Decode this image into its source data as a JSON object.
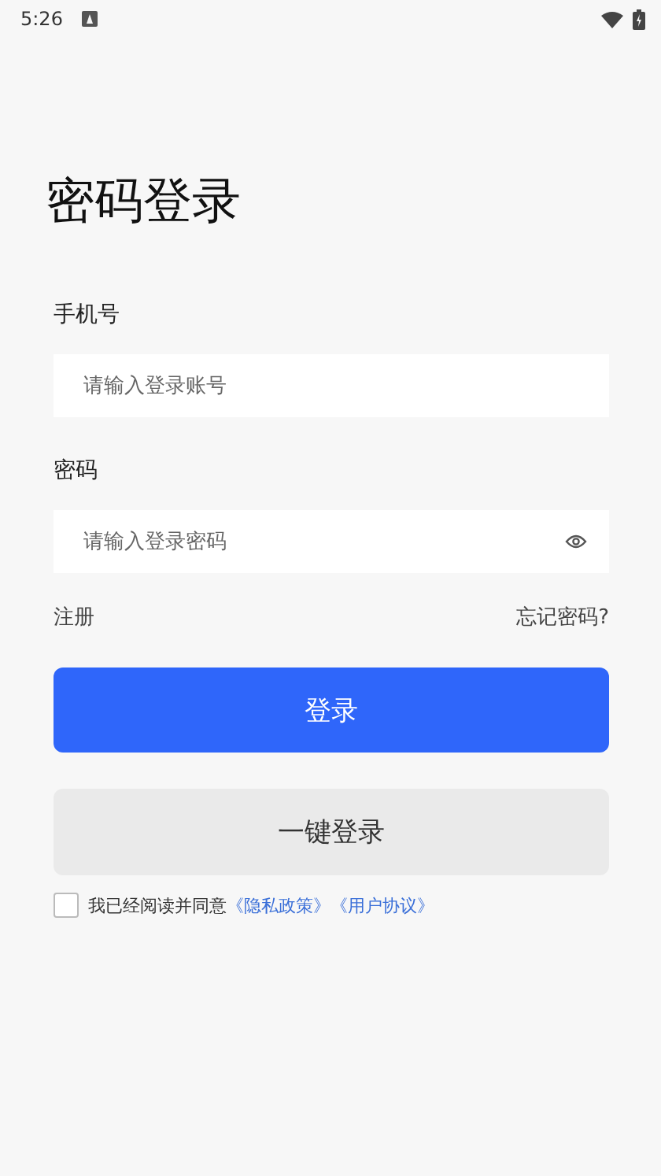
{
  "status_bar": {
    "time": "5:26"
  },
  "title": "密码登录",
  "fields": [
    {
      "label": "手机号",
      "placeholder": "请输入登录账号",
      "kind": "text"
    },
    {
      "label": "密码",
      "placeholder": "请输入登录密码",
      "kind": "password"
    }
  ],
  "links": {
    "register": "注册",
    "forgot": "忘记密码?"
  },
  "login_button": "登录",
  "one_click_button": "一键登录",
  "agreement": {
    "checked": false,
    "text": "我已经阅读并同意",
    "links": [
      "《隐私政策》",
      "《用户协议》"
    ]
  }
}
